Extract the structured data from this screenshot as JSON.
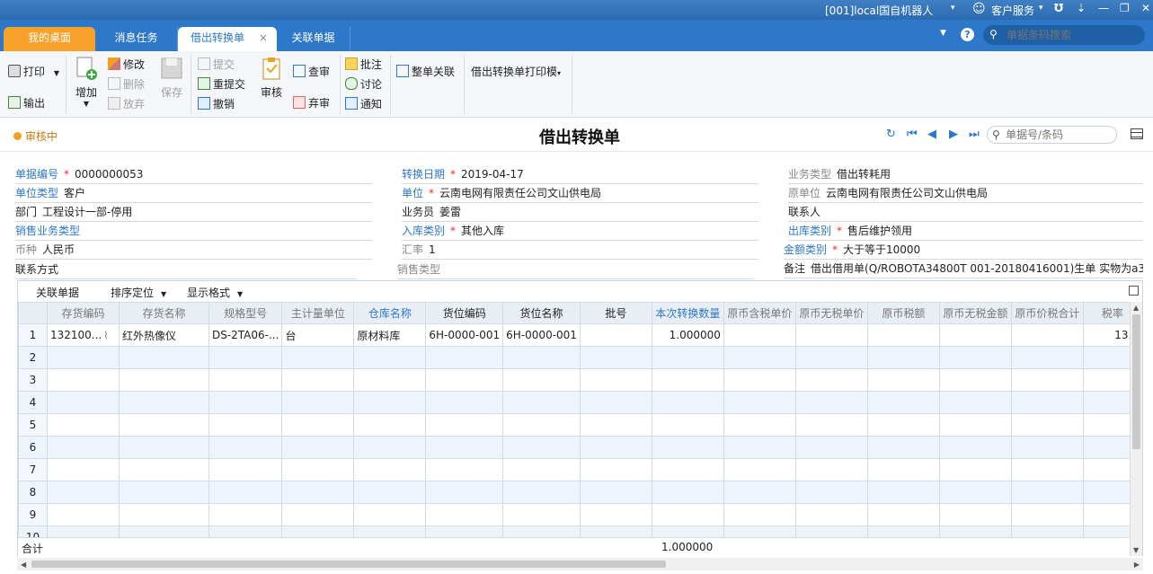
{
  "titlebar": {
    "user": "[001]local国自机器人",
    "service": "客户服务",
    "search_placeholder": "单据条码搜索"
  },
  "tabs": [
    {
      "label": "我的桌面"
    },
    {
      "label": "消息任务"
    },
    {
      "label": "借出转换单"
    },
    {
      "label": "关联单据"
    }
  ],
  "toolbar": {
    "print": "打印",
    "export": "输出",
    "add": "增加",
    "edit": "修改",
    "delete": "删除",
    "discard": "放弃",
    "save": "保存",
    "submit": "提交",
    "resubmit": "重提交",
    "revoke": "撤销",
    "audit": "审核",
    "check": "查审",
    "abandon": "弃审",
    "annotate": "批注",
    "discuss": "讨论",
    "notify": "通知",
    "link_all": "整单关联",
    "print_template": "借出转换单打印模"
  },
  "header": {
    "status": "审核中",
    "title": "借出转换单",
    "doc_search_placeholder": "单据号/条码"
  },
  "fields": {
    "doc_no_label": "单据编号",
    "doc_no": "0000000053",
    "unit_type_label": "单位类型",
    "unit_type": "客户",
    "dept_label": "部门",
    "dept": "工程设计一部-停用",
    "sales_type_label": "销售业务类型",
    "sales_type": "",
    "currency_label": "币种",
    "currency": "人民币",
    "contact_method_label": "联系方式",
    "contact_method": "",
    "date_label": "转换日期",
    "date": "2019-04-17",
    "unit_label": "单位",
    "unit": "云南电网有限责任公司文山供电局",
    "salesman_label": "业务员",
    "salesman": "姜雷",
    "in_type_label": "入库类别",
    "in_type": "其他入库",
    "rate_label": "汇率",
    "rate": "1",
    "sale_type_label": "销售类型",
    "sale_type": "",
    "biz_type_label": "业务类型",
    "biz_type": "借出转耗用",
    "orig_unit_label": "原单位",
    "orig_unit": "云南电网有限责任公司文山供电局",
    "contact_label": "联系人",
    "contact": "",
    "out_type_label": "出库类别",
    "out_type": "售后维护领用",
    "amount_type_label": "金额类别",
    "amount_type": "大于等于10000",
    "remark_label": "备注",
    "remark": "借出借用单(Q/ROBOTA34800T 001-20180416001)生单 实物为a3"
  },
  "grid": {
    "tools": [
      "关联单据",
      "排序定位",
      "显示格式"
    ],
    "columns": [
      "存货编码",
      "存货名称",
      "规格型号",
      "主计量单位",
      "仓库名称",
      "货位编码",
      "货位名称",
      "批号",
      "本次转换数量",
      "原币含税单价",
      "原币无税单价",
      "原币税额",
      "原币无税金额",
      "原币价税合计",
      "税率"
    ],
    "rows": [
      {
        "no": "1",
        "cells": [
          "132100...",
          "红外热像仪",
          "DS-2TA06-...",
          "台",
          "原材料库",
          "6H-0000-001",
          "6H-0000-001",
          "",
          "1.000000",
          "",
          "",
          "",
          "",
          "",
          "13.0"
        ]
      },
      {
        "no": "2",
        "cells": [
          "",
          "",
          "",
          "",
          "",
          "",
          "",
          "",
          "",
          "",
          "",
          "",
          "",
          "",
          ""
        ]
      },
      {
        "no": "3",
        "cells": [
          "",
          "",
          "",
          "",
          "",
          "",
          "",
          "",
          "",
          "",
          "",
          "",
          "",
          "",
          ""
        ]
      },
      {
        "no": "4",
        "cells": [
          "",
          "",
          "",
          "",
          "",
          "",
          "",
          "",
          "",
          "",
          "",
          "",
          "",
          "",
          ""
        ]
      },
      {
        "no": "5",
        "cells": [
          "",
          "",
          "",
          "",
          "",
          "",
          "",
          "",
          "",
          "",
          "",
          "",
          "",
          "",
          ""
        ]
      },
      {
        "no": "6",
        "cells": [
          "",
          "",
          "",
          "",
          "",
          "",
          "",
          "",
          "",
          "",
          "",
          "",
          "",
          "",
          ""
        ]
      },
      {
        "no": "7",
        "cells": [
          "",
          "",
          "",
          "",
          "",
          "",
          "",
          "",
          "",
          "",
          "",
          "",
          "",
          "",
          ""
        ]
      },
      {
        "no": "8",
        "cells": [
          "",
          "",
          "",
          "",
          "",
          "",
          "",
          "",
          "",
          "",
          "",
          "",
          "",
          "",
          ""
        ]
      },
      {
        "no": "9",
        "cells": [
          "",
          "",
          "",
          "",
          "",
          "",
          "",
          "",
          "",
          "",
          "",
          "",
          "",
          "",
          ""
        ]
      },
      {
        "no": "10",
        "cells": [
          "",
          "",
          "",
          "",
          "",
          "",
          "",
          "",
          "",
          "",
          "",
          "",
          "",
          "",
          ""
        ]
      }
    ],
    "sum_label": "合计",
    "sum_qty": "1.000000"
  }
}
